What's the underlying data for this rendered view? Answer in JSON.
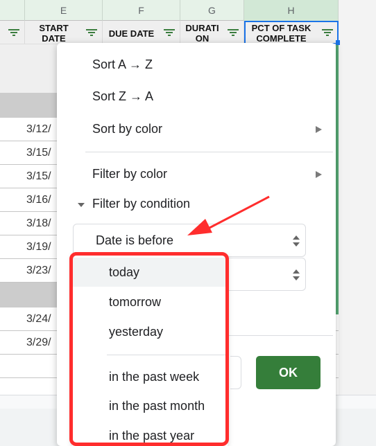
{
  "columns": [
    {
      "letter": "",
      "header": "",
      "selected": false
    },
    {
      "letter": "E",
      "header": "START\nDATE",
      "selected": false
    },
    {
      "letter": "F",
      "header": "DUE DATE",
      "selected": false
    },
    {
      "letter": "G",
      "header": "DURATI\nON",
      "selected": false
    },
    {
      "letter": "H",
      "header": "PCT OF TASK\nCOMPLETE",
      "selected": true
    }
  ],
  "rows": [
    {
      "type": "band-light",
      "date": ""
    },
    {
      "type": "band-gray",
      "date": ""
    },
    {
      "type": "data",
      "date": "3/12/"
    },
    {
      "type": "data",
      "date": "3/15/"
    },
    {
      "type": "data",
      "date": "3/15/"
    },
    {
      "type": "data",
      "date": "3/16/"
    },
    {
      "type": "data",
      "date": "3/18/"
    },
    {
      "type": "data",
      "date": "3/19/"
    },
    {
      "type": "data",
      "date": "3/23/"
    },
    {
      "type": "band-gray",
      "date": ""
    },
    {
      "type": "data",
      "date": "3/24/"
    },
    {
      "type": "data",
      "date": "3/29/"
    },
    {
      "type": "data",
      "date": ""
    },
    {
      "type": "data",
      "date": ""
    },
    {
      "type": "band-gray",
      "date": ""
    }
  ],
  "menu": {
    "sort_az": "Sort A → Z",
    "sort_za": "Sort Z → A",
    "sort_by_color": "Sort by color",
    "filter_by_color": "Filter by color",
    "filter_by_condition": "Filter by condition",
    "condition_value": "Date is before",
    "date_value": "",
    "ok_label": "OK"
  },
  "dropdown": {
    "hovered": "today",
    "options": [
      "today",
      "tomorrow",
      "yesterday",
      "in the past week",
      "in the past month",
      "in the past year"
    ]
  },
  "colors": {
    "accent_green": "#357e3a",
    "filter_icon": "#3b7d3e",
    "highlight_red": "#ff2d2d",
    "selection_blue": "#1a73e8"
  }
}
